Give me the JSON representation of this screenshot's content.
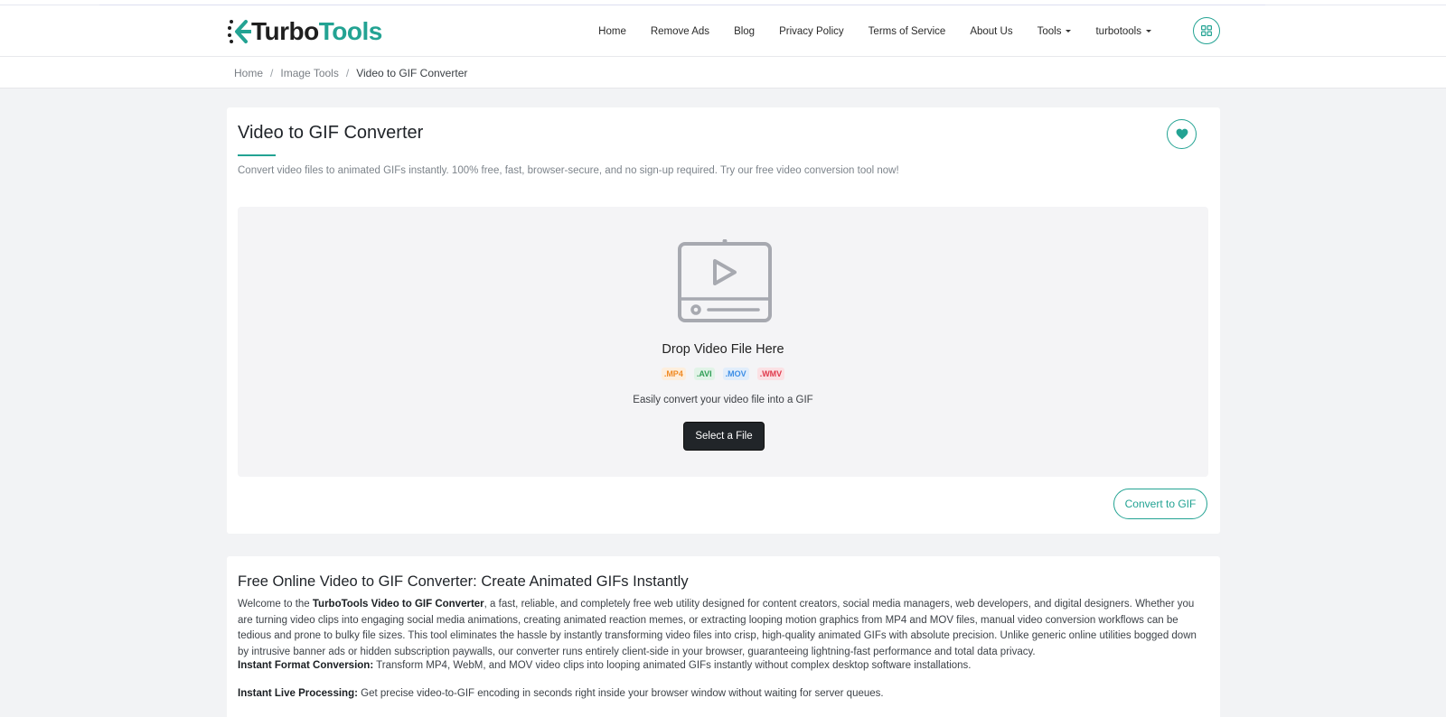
{
  "brand": {
    "name_part1": "Turbo",
    "name_part2": "Tools",
    "accent_color": "#23a393"
  },
  "nav": {
    "items": [
      {
        "label": "Home"
      },
      {
        "label": "Remove Ads"
      },
      {
        "label": "Blog"
      },
      {
        "label": "Privacy Policy"
      },
      {
        "label": "Terms of Service"
      },
      {
        "label": "About Us"
      },
      {
        "label": "Tools"
      },
      {
        "label": "turbotools"
      }
    ],
    "grid_icon": "apps-grid-icon"
  },
  "breadcrumb": {
    "items": [
      "Home",
      "Image Tools",
      "Video to GIF Converter"
    ],
    "separator": "/"
  },
  "tool": {
    "title": "Video to GIF Converter",
    "subtitle": "Convert video files to animated GIFs instantly. 100% free, fast, browser-secure, and no sign-up required. Try our free video conversion tool now!",
    "favorite_icon": "heart-icon",
    "dropzone": {
      "icon": "video-file-icon",
      "title": "Drop Video File Here",
      "formats": [
        {
          "label": ".MP4",
          "color": "#f08a24",
          "bg": "#fdeedd"
        },
        {
          "label": ".AVI",
          "color": "#2f9e55",
          "bg": "#e1f3e7"
        },
        {
          "label": ".MOV",
          "color": "#3d8ee6",
          "bg": "#e1edfb"
        },
        {
          "label": ".WMV",
          "color": "#e0394b",
          "bg": "#fbe1e4"
        }
      ],
      "description": "Easily convert your video file into a GIF",
      "select_label": "Select a File"
    },
    "convert_label": "Convert to GIF"
  },
  "info": {
    "heading": "Free Online Video to GIF Converter: Create Animated GIFs Instantly",
    "intro_prefix": "Welcome to the ",
    "intro_bold": "TurboTools Video to GIF Converter",
    "intro_rest": ", a fast, reliable, and completely free web utility designed for content creators, social media managers, web developers, and digital designers. Whether you are turning video clips into engaging social media animations, creating animated reaction memes, or extracting looping motion graphics from MP4 and MOV files, manual video conversion workflows can be tedious and prone to bulky file sizes. This tool eliminates the hassle by instantly transforming video files into crisp, high-quality animated GIFs with absolute precision. Unlike generic online utilities bogged down by intrusive banner ads or hidden subscription paywalls, our converter runs entirely client-side in your browser, guaranteeing lightning-fast performance and total data privacy.",
    "features": [
      {
        "title": "Instant Format Conversion:",
        "text": " Transform MP4, WebM, and MOV video clips into looping animated GIFs instantly without complex desktop software installations."
      },
      {
        "title": "Instant Live Processing:",
        "text": " Get precise video-to-GIF encoding in seconds right inside your browser window without waiting for server queues."
      }
    ]
  }
}
